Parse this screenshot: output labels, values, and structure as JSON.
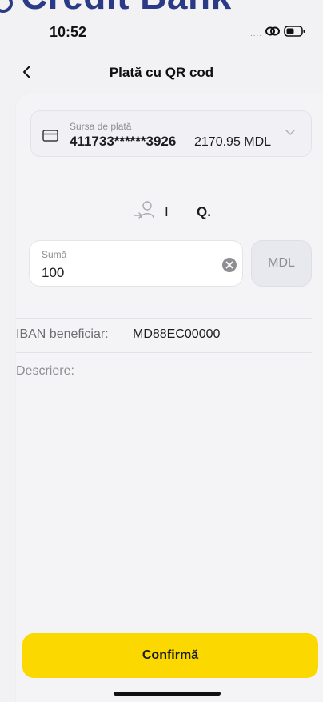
{
  "brand": {
    "name": "Credit Bank"
  },
  "status_bar": {
    "time": "10:52",
    "signal": "...."
  },
  "nav": {
    "title": "Plată cu QR cod",
    "back_icon": "chevron-left-icon"
  },
  "payment_source": {
    "label": "Sursa de plată",
    "card_number": "411733******3926",
    "balance": "2170.95 MDL",
    "icon": "credit-card-icon"
  },
  "recipient": {
    "icon": "person-transfer-icon",
    "initial_1": "I",
    "initial_2": "Q."
  },
  "amount": {
    "label": "Sumă",
    "value": "100",
    "currency": "MDL"
  },
  "iban": {
    "label": "IBAN beneficiar:",
    "value": "MD88EC00000"
  },
  "description": {
    "label": "Descriere:"
  },
  "confirm": {
    "label": "Confirmă"
  },
  "colors": {
    "accent": "#fbd800",
    "brand": "#2b3a86",
    "background": "#f2f2f4"
  }
}
